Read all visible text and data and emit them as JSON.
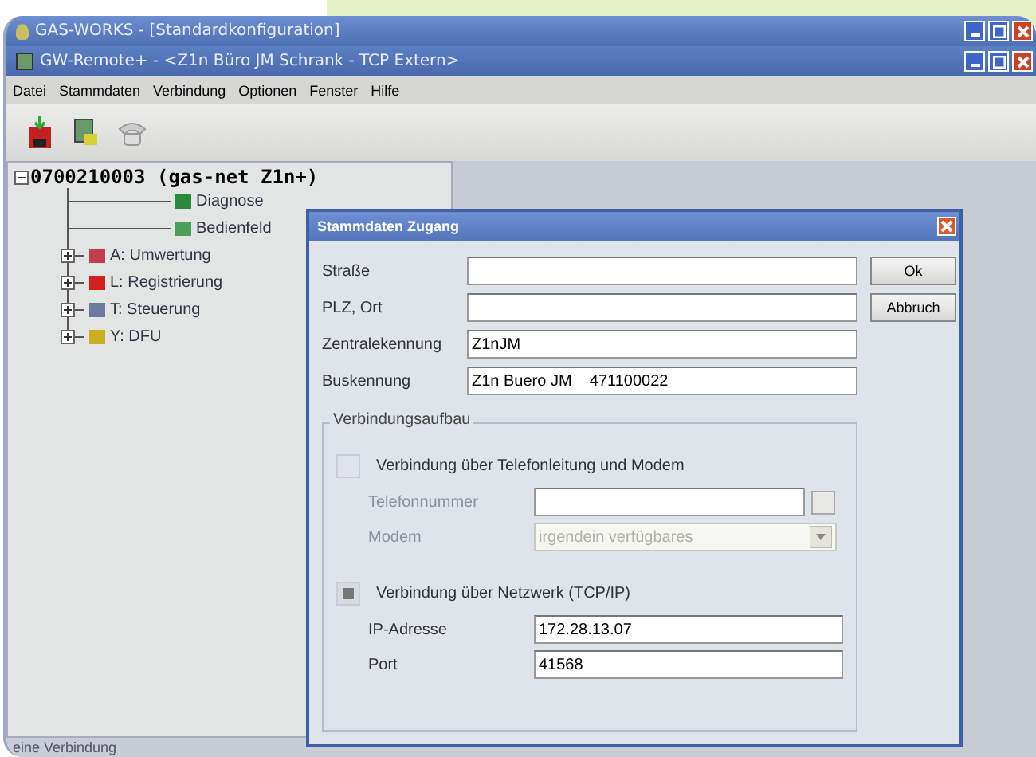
{
  "main_window": {
    "title": "GAS-WORKS - [Standardkonfiguration]"
  },
  "child_window": {
    "title": "GW-Remote+ - <Z1n Büro JM Schrank - TCP Extern>"
  },
  "menu": [
    "Datei",
    "Stammdaten",
    "Verbindung",
    "Optionen",
    "Fenster",
    "Hilfe"
  ],
  "tree": {
    "label": "0700210003 (gas-net Z1n+)",
    "expanded": true,
    "children": [
      {
        "label": "Diagnose",
        "kind": "leaf"
      },
      {
        "label": "Bedienfeld",
        "kind": "leaf"
      },
      {
        "label": "A: Umwertung",
        "kind": "folder",
        "expanded": false
      },
      {
        "label": "L: Registrierung",
        "kind": "folder",
        "expanded": false
      },
      {
        "label": "T: Steuerung",
        "kind": "folder",
        "expanded": false
      },
      {
        "label": "Y: DFU",
        "kind": "folder",
        "expanded": false
      }
    ]
  },
  "dialog": {
    "title": "Stammdaten Zugang",
    "fields": [
      {
        "label": "Straße"
      },
      {
        "label": "PLZ, Ort"
      },
      {
        "label": "Zentralekennung",
        "value": "Z1nJM"
      },
      {
        "label": "Buskennung",
        "value": "Z1n Buero JM    471100022"
      }
    ],
    "buttons": [
      "Ok",
      "Abbruch"
    ],
    "group": {
      "title": "Verbindungsaufbau",
      "phone": {
        "label": "Verbindung über Telefonleitung und Modem",
        "checked": false,
        "number_label": "Telefonnummer",
        "modem_label": "Modem",
        "modem": "irgendein verfügbares",
        "disabled": true
      },
      "network": {
        "label": "Verbindung über Netzwerk (TCP/IP)",
        "checked": true,
        "ip_label": "IP-Adresse",
        "ip": "172.28.13.07",
        "port_label": "Port",
        "port": "41568"
      }
    }
  },
  "status_bar": "eine Verbindung"
}
